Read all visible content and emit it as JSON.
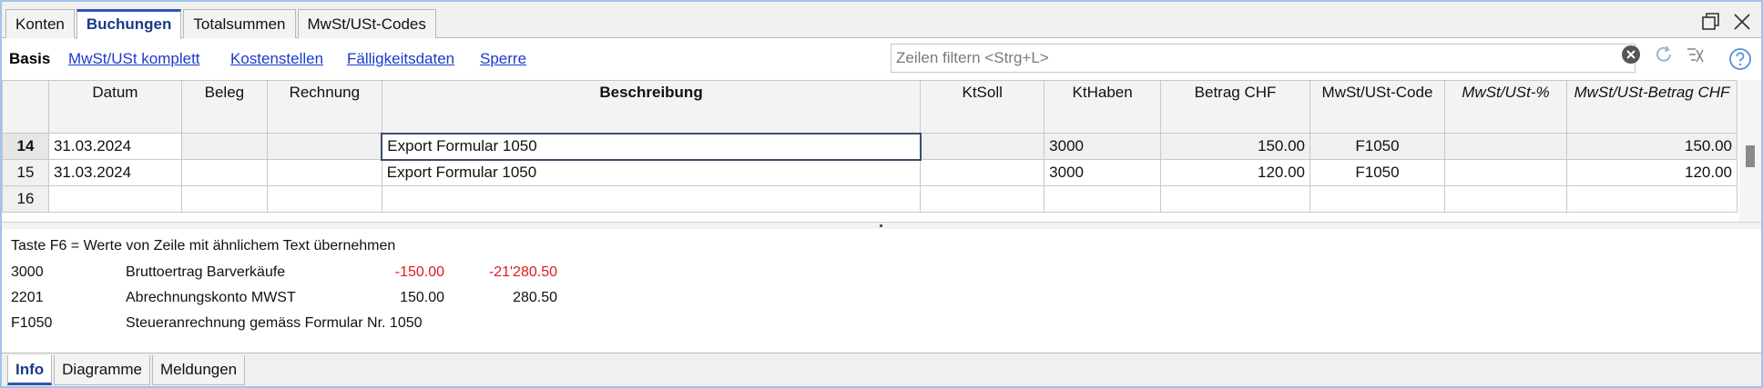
{
  "tabs": [
    "Konten",
    "Buchungen",
    "Totalsummen",
    "MwSt/USt-Codes"
  ],
  "active_tab": "Buchungen",
  "views": {
    "basis": "Basis",
    "links": [
      "MwSt/USt komplett",
      "Kostenstellen",
      "Fälligkeitsdaten",
      "Sperre"
    ]
  },
  "filter": {
    "placeholder": "Zeilen filtern <Strg+L>"
  },
  "table": {
    "columns": [
      "Datum",
      "Beleg",
      "Rechnung",
      "Beschreibung",
      "KtSoll",
      "KtHaben",
      "Betrag CHF",
      "MwSt/USt-Code",
      "MwSt/USt-%",
      "MwSt/USt-Betrag CHF"
    ],
    "rows": [
      {
        "row": "14",
        "datum": "31.03.2024",
        "beleg": "",
        "rechnung": "",
        "beschreibung": "Export Formular 1050",
        "ktsoll": "",
        "kthaben": "3000",
        "betrag": "150.00",
        "code": "F1050",
        "pct": "",
        "mwst_betrag": "150.00"
      },
      {
        "row": "15",
        "datum": "31.03.2024",
        "beleg": "",
        "rechnung": "",
        "beschreibung": "Export Formular 1050",
        "ktsoll": "",
        "kthaben": "3000",
        "betrag": "120.00",
        "code": "F1050",
        "pct": "",
        "mwst_betrag": "120.00"
      },
      {
        "row": "16",
        "datum": "",
        "beleg": "",
        "rechnung": "",
        "beschreibung": "",
        "ktsoll": "",
        "kthaben": "",
        "betrag": "",
        "code": "",
        "pct": "",
        "mwst_betrag": ""
      }
    ]
  },
  "info": {
    "hint": "Taste F6 = Werte von Zeile mit ähnlichem Text übernehmen",
    "lines": [
      {
        "code": "3000",
        "label": "Bruttoertrag Barverkäufe",
        "amount": "-150.00",
        "balance": "-21'280.50",
        "negative": true
      },
      {
        "code": "2201",
        "label": "Abrechnungskonto MWST",
        "amount": "150.00",
        "balance": "280.50",
        "negative": false
      },
      {
        "code": "F1050",
        "label": "Steueranrechnung gemäss Formular Nr. 1050",
        "amount": "",
        "balance": "",
        "negative": false
      }
    ]
  },
  "bottom_tabs": [
    "Info",
    "Diagramme",
    "Meldungen"
  ],
  "active_bottom_tab": "Info",
  "colors": {
    "accent": "#2f55b0",
    "negative": "#e11a1a",
    "link": "#1a3ad0"
  }
}
